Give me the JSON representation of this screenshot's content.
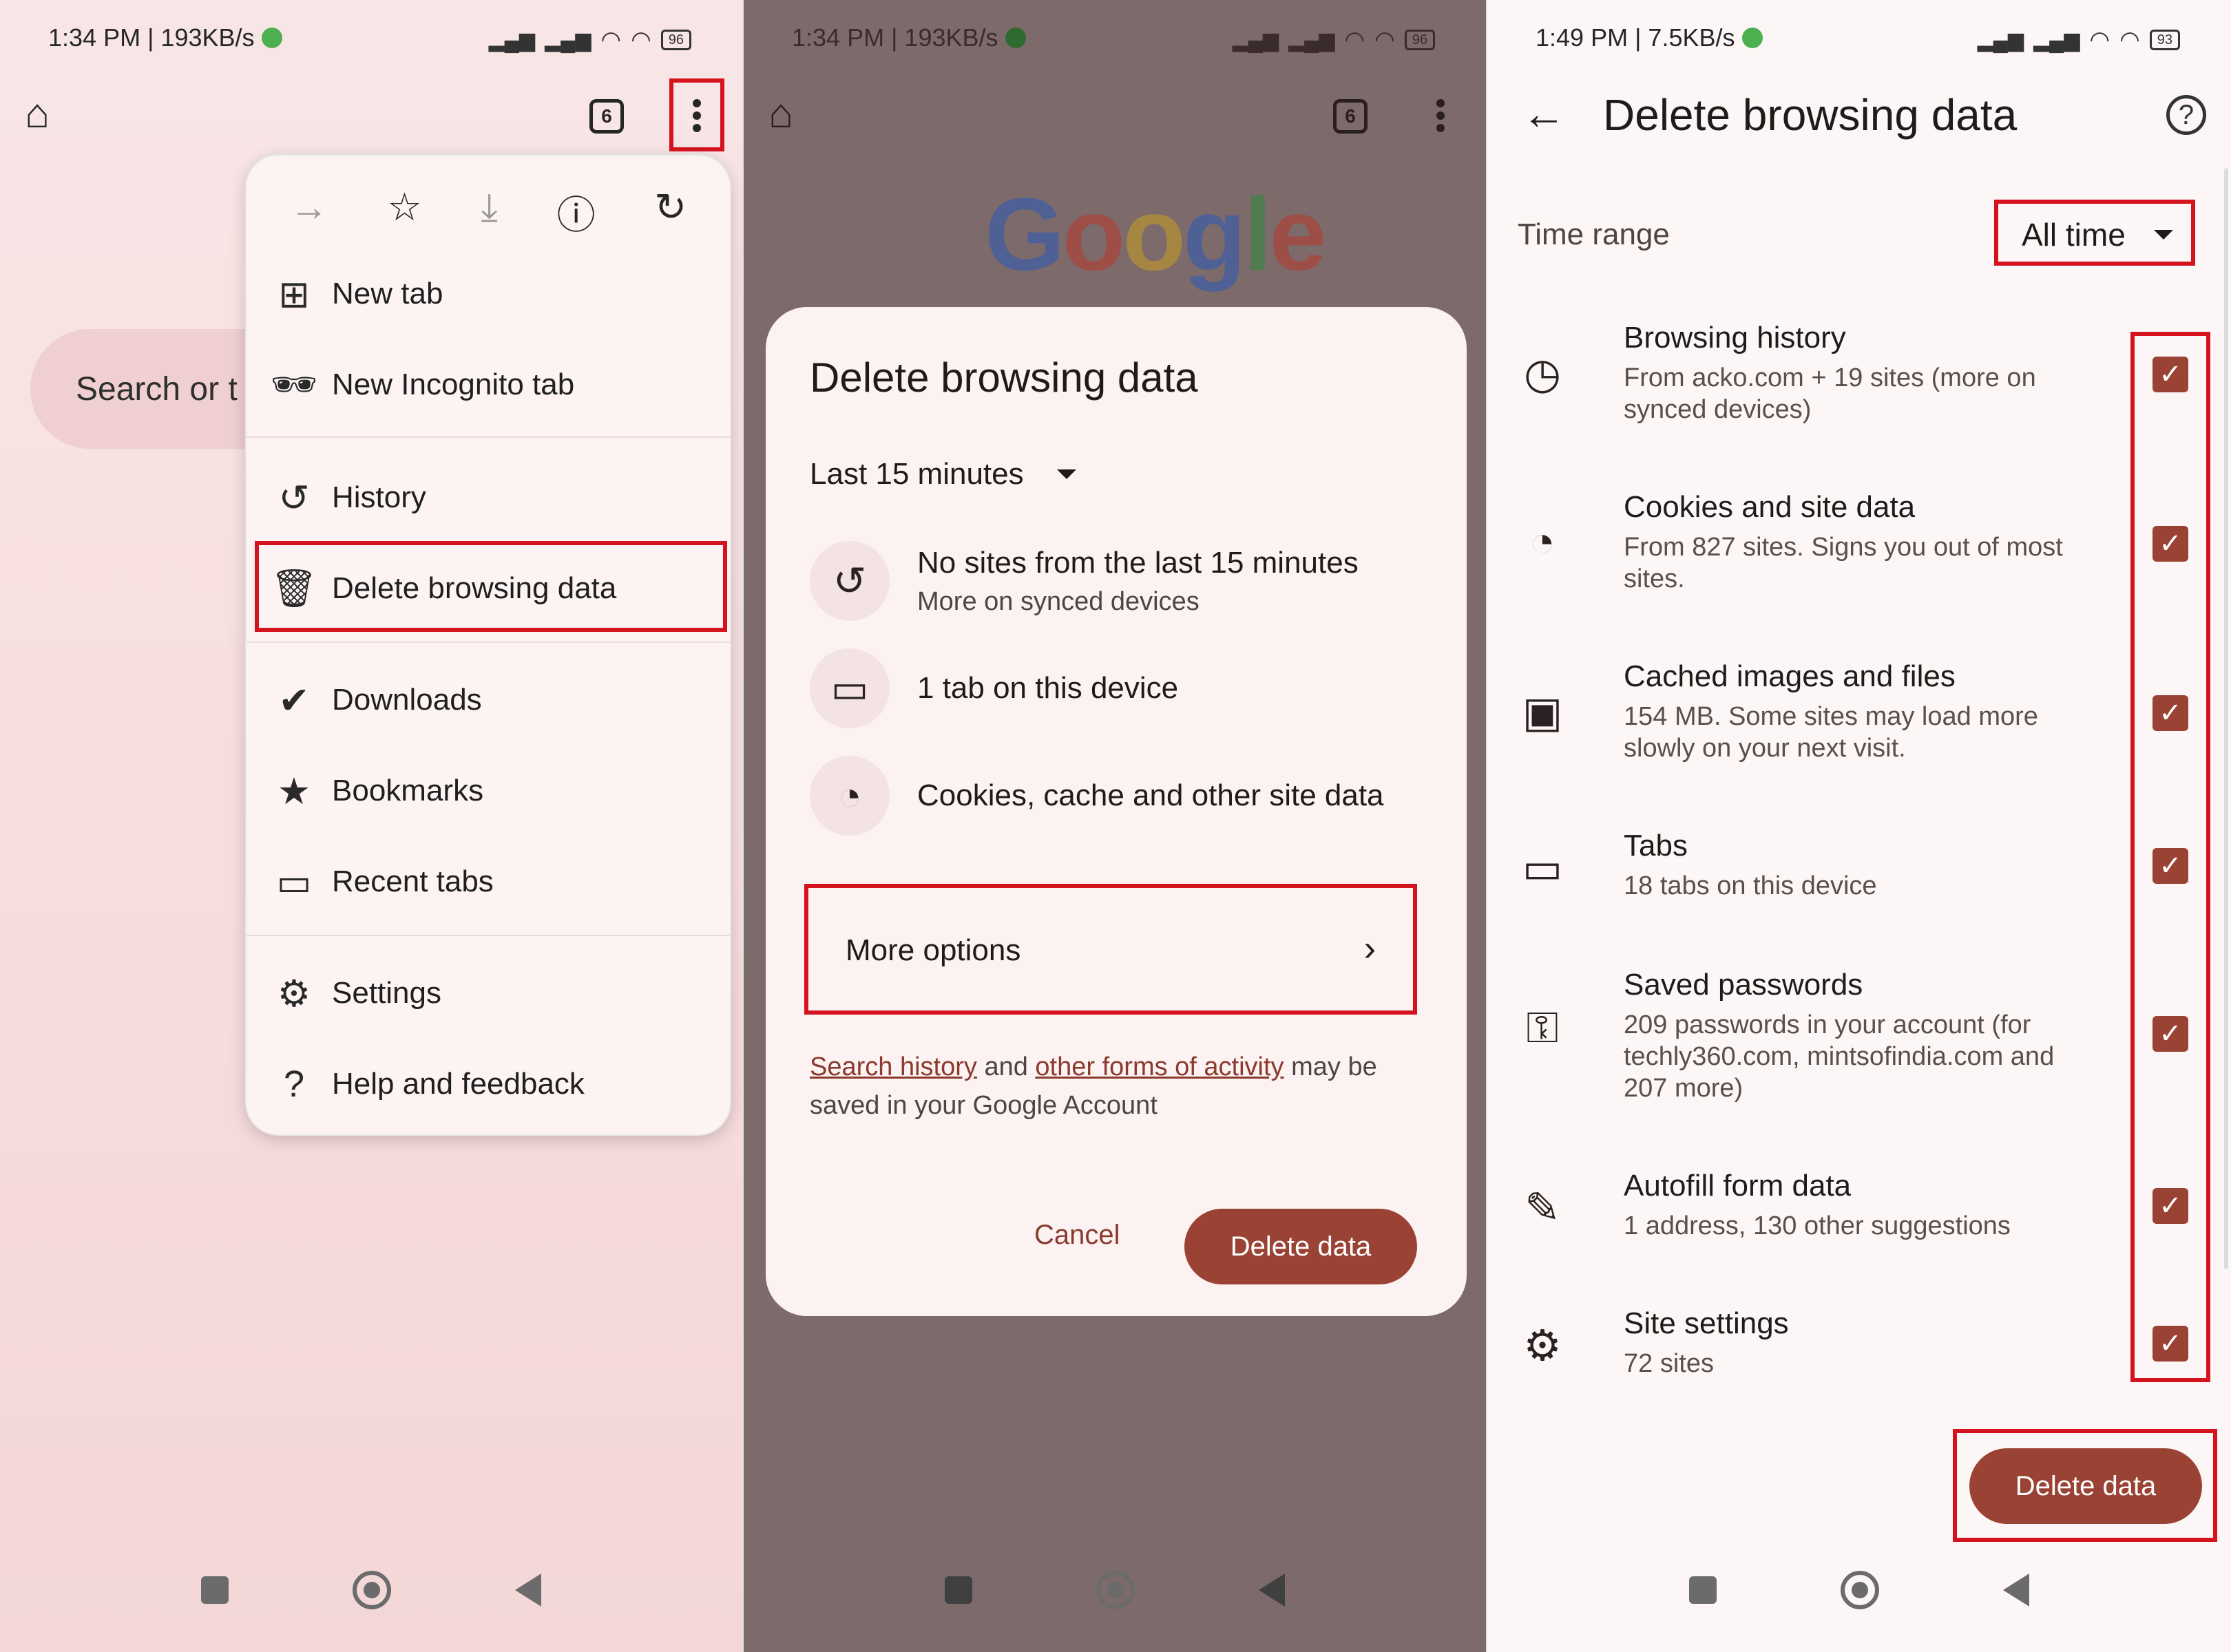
{
  "panel1": {
    "status_time": "1:34 PM | 193KB/s",
    "battery": "96",
    "tab_count": "6",
    "search_placeholder": "Search or t",
    "menu": {
      "items": [
        {
          "label": "New tab",
          "icon": "plus-box-icon"
        },
        {
          "label": "New Incognito tab",
          "icon": "incognito-icon"
        },
        {
          "label": "History",
          "icon": "history-icon"
        },
        {
          "label": "Delete browsing data",
          "icon": "trash-icon"
        },
        {
          "label": "Downloads",
          "icon": "download-done-icon"
        },
        {
          "label": "Bookmarks",
          "icon": "star-filled-icon"
        },
        {
          "label": "Recent tabs",
          "icon": "devices-icon"
        },
        {
          "label": "Settings",
          "icon": "gear-icon"
        },
        {
          "label": "Help and feedback",
          "icon": "help-icon"
        }
      ]
    }
  },
  "panel2": {
    "status_time": "1:34 PM | 193KB/s",
    "battery": "96",
    "tab_count": "6",
    "google_logo": "Google",
    "dialog": {
      "title": "Delete browsing data",
      "range": "Last 15 minutes",
      "rows": [
        {
          "title": "No sites from the last 15 minutes",
          "subtitle": "More on synced devices",
          "icon": "history-icon"
        },
        {
          "title": "1 tab on this device",
          "subtitle": "",
          "icon": "tab-icon"
        },
        {
          "title": "Cookies, cache and other site data",
          "subtitle": "",
          "icon": "cookie-icon"
        }
      ],
      "more_options": "More options",
      "note_link1": "Search history",
      "note_and": " and ",
      "note_link2": "other forms of activity",
      "note_rest": " may be saved in your Google Account",
      "cancel": "Cancel",
      "delete": "Delete data"
    }
  },
  "panel3": {
    "status_time": "1:49 PM | 7.5KB/s",
    "battery": "93",
    "title": "Delete browsing data",
    "time_range_label": "Time range",
    "time_range_value": "All time",
    "rows": [
      {
        "title": "Browsing history",
        "subtitle": "From acko.com + 19 sites (more on synced devices)",
        "checked": true,
        "icon": "clock-icon"
      },
      {
        "title": "Cookies and site data",
        "subtitle": "From 827 sites. Signs you out of most sites.",
        "checked": true,
        "icon": "cookie-icon"
      },
      {
        "title": "Cached images and files",
        "subtitle": "154 MB. Some sites may load more slowly on your next visit.",
        "checked": true,
        "icon": "images-icon"
      },
      {
        "title": "Tabs",
        "subtitle": "18 tabs on this device",
        "checked": true,
        "icon": "tab-icon"
      },
      {
        "title": "Saved passwords",
        "subtitle": "209 passwords in your account (for techly360.com, mintsofindia.com and 207 more)",
        "checked": true,
        "icon": "key-icon"
      },
      {
        "title": "Autofill form data",
        "subtitle": "1 address, 130 other suggestions",
        "checked": true,
        "icon": "pencil-icon"
      },
      {
        "title": "Site settings",
        "subtitle": "72 sites",
        "checked": true,
        "icon": "site-settings-icon"
      }
    ],
    "delete": "Delete data"
  },
  "colors": {
    "accent": "#9a4335",
    "highlight_box": "#d5131f",
    "menu_bg": "#fdf3f3"
  }
}
